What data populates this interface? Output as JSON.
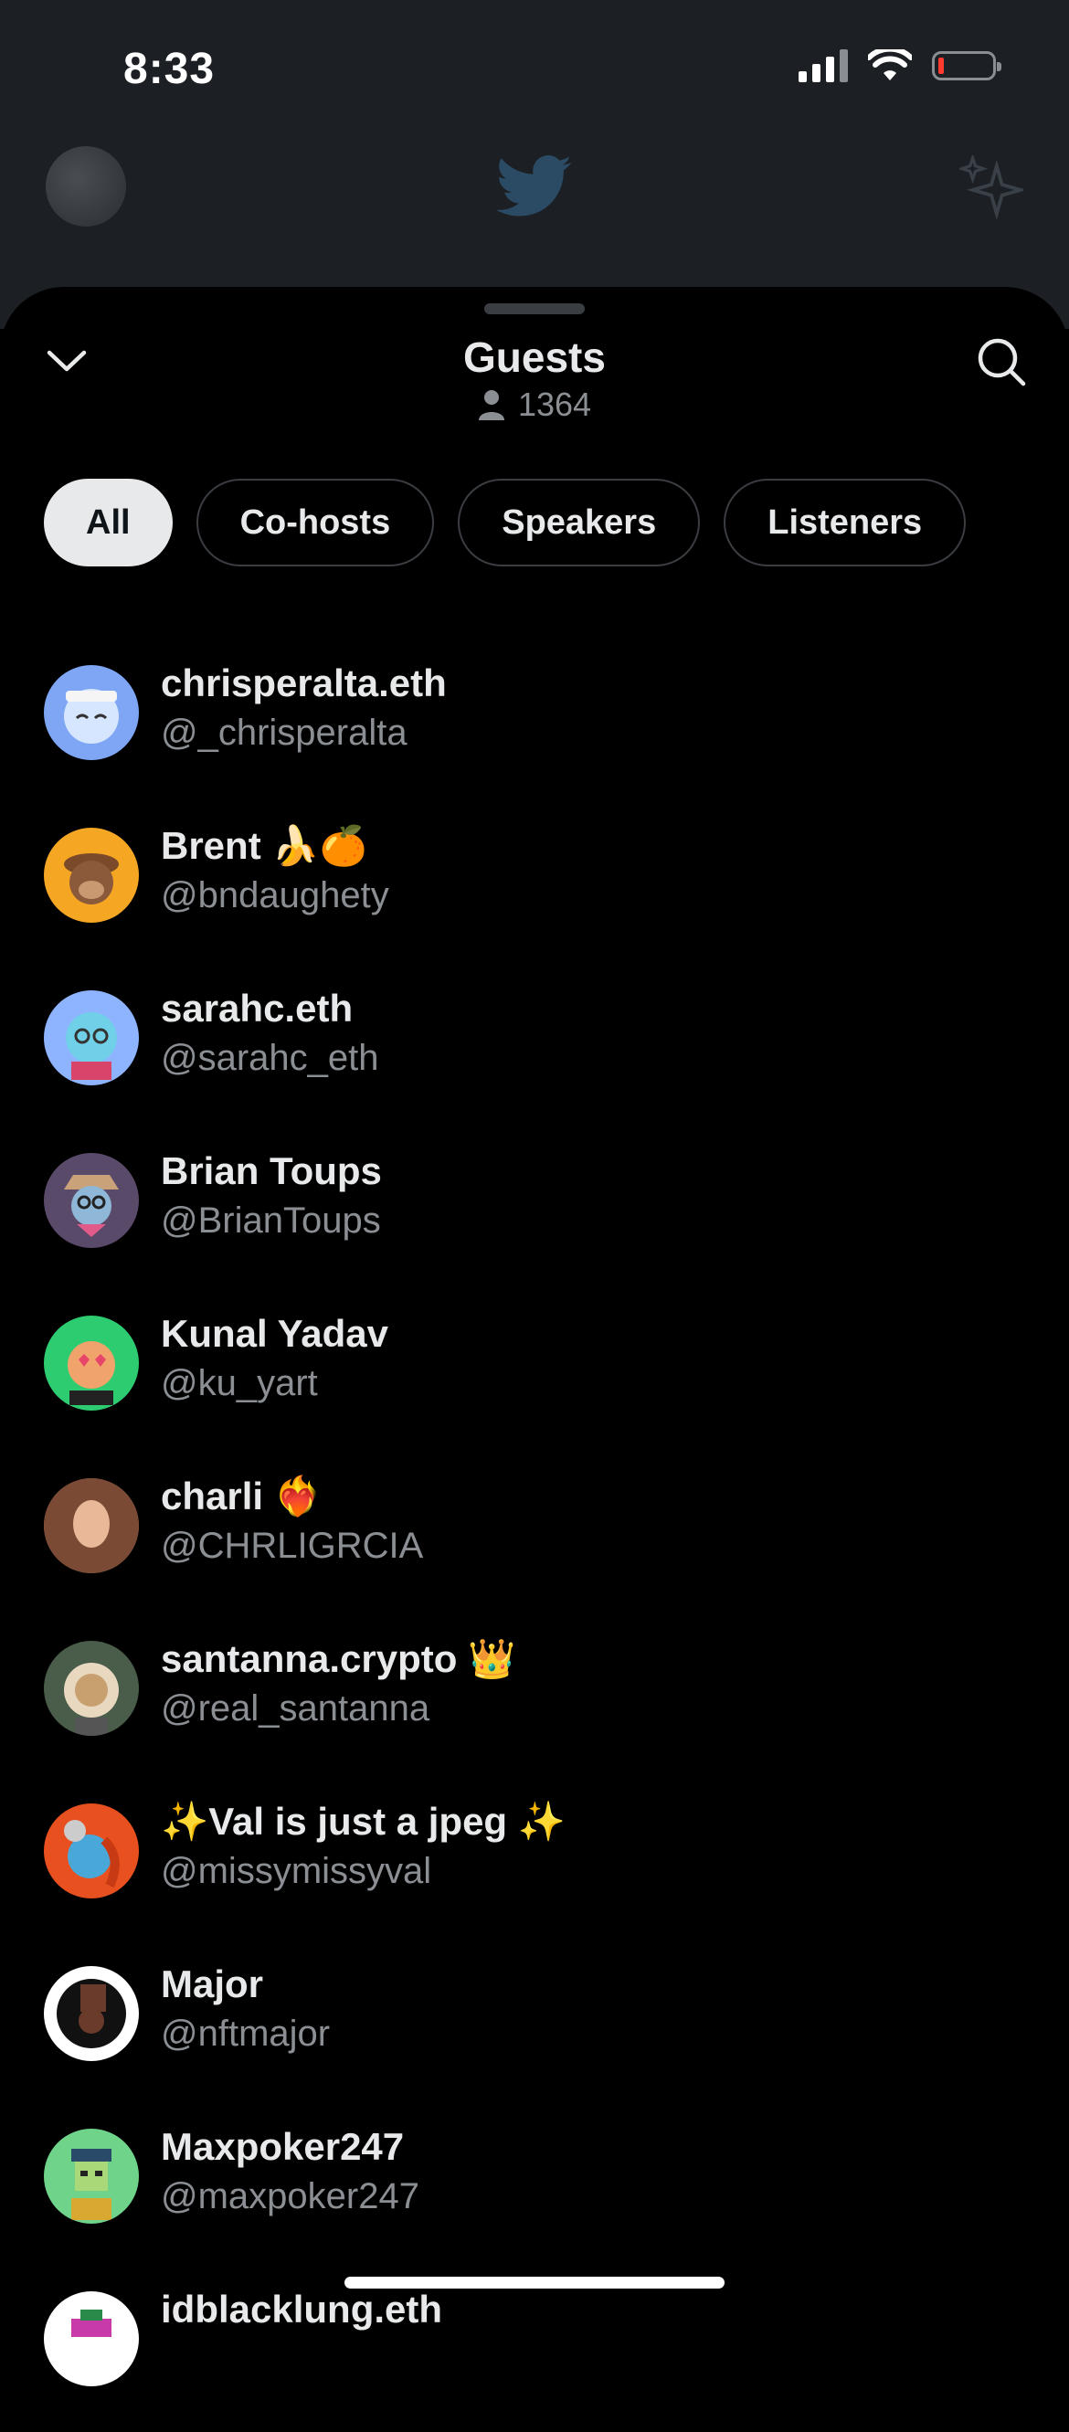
{
  "status_bar": {
    "time": "8:33"
  },
  "sheet": {
    "title": "Guests",
    "guest_count": "1364",
    "tabs": [
      {
        "label": "All",
        "active": true
      },
      {
        "label": "Co-hosts",
        "active": false
      },
      {
        "label": "Speakers",
        "active": false
      },
      {
        "label": "Listeners",
        "active": false
      }
    ]
  },
  "guests": [
    {
      "name": "chrisperalta.eth",
      "handle": "@_chrisperalta",
      "avatar_color": "#7fa6f5"
    },
    {
      "name": "Brent 🍌🍊",
      "handle": "@bndaughety",
      "avatar_color": "#f5a623"
    },
    {
      "name": "sarahc.eth",
      "handle": "@sarahc_eth",
      "avatar_color": "#8fb4ff"
    },
    {
      "name": "Brian Toups",
      "handle": "@BrianToups",
      "avatar_color": "#5a4a6a"
    },
    {
      "name": "Kunal Yadav",
      "handle": "@ku_yart",
      "avatar_color": "#2ecc71"
    },
    {
      "name": "charli ❤️‍🔥",
      "handle": "@CHRLIGRCIA",
      "avatar_color": "#a0705a"
    },
    {
      "name": "santanna.crypto 👑",
      "handle": "@real_santanna",
      "avatar_color": "#4a5d4a"
    },
    {
      "name": "✨Val is just a jpeg ✨",
      "handle": "@missymissyval",
      "avatar_color": "#e8501f"
    },
    {
      "name": "Major",
      "handle": "@nftmajor",
      "avatar_color": "#ffffff"
    },
    {
      "name": "Maxpoker247",
      "handle": "@maxpoker247",
      "avatar_color": "#6fd38a"
    },
    {
      "name": "idblacklung.eth",
      "handle": "",
      "avatar_color": "#ffffff"
    }
  ],
  "colors": {
    "accent": "#e7e9ea",
    "muted": "#8b8f94",
    "battery_low": "#ff3b30"
  }
}
